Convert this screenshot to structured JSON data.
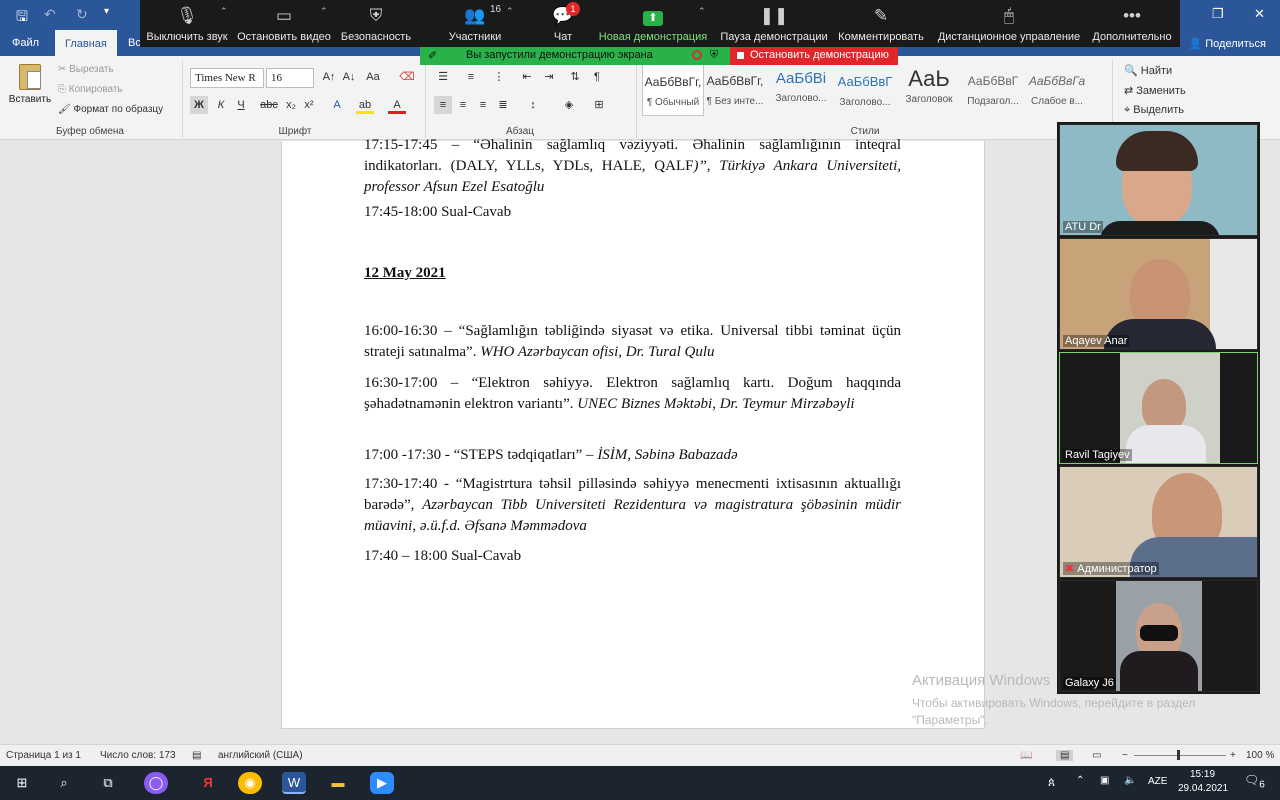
{
  "word": {
    "tabs": [
      "Файл",
      "Главная",
      "Вс"
    ],
    "share_label": "Поделиться",
    "clipboard": {
      "paste": "Вставить",
      "cut": "Вырезать",
      "copy": "Копировать",
      "format_painter": "Формат по образцу",
      "group": "Буфер обмена"
    },
    "font": {
      "name": "Times New R",
      "size": "16",
      "group": "Шрифт"
    },
    "paragraph_group": "Абзац",
    "styles": {
      "items": [
        {
          "preview": "АаБбВвГг,",
          "name": "¶ Обычный"
        },
        {
          "preview": "АаБбВвГг,",
          "name": "¶ Без инте..."
        },
        {
          "preview": "АаБбВі",
          "name": "Заголово..."
        },
        {
          "preview": "АаБбВвГ",
          "name": "Заголово..."
        },
        {
          "preview": "АаЬ",
          "name": "Заголовок"
        },
        {
          "preview": "АаБбВвГ",
          "name": "Подзагол..."
        },
        {
          "preview": "АаБбВвГа",
          "name": "Слабое в..."
        }
      ],
      "group": "Стили"
    },
    "editing": {
      "find": "Найти",
      "replace": "Заменить",
      "select": "Выделить"
    }
  },
  "zoom": {
    "toolbar": [
      {
        "label": "Выключить звук",
        "icon": "microphone-icon"
      },
      {
        "label": "Остановить видео",
        "icon": "video-camera-icon"
      },
      {
        "label": "Безопасность",
        "icon": "shield-icon"
      },
      {
        "label": "Участники",
        "icon": "participants-icon",
        "count": "16"
      },
      {
        "label": "Чат",
        "icon": "chat-icon",
        "badge": "1"
      },
      {
        "label": "Новая демонстрация",
        "icon": "share-screen-icon"
      },
      {
        "label": "Пауза демонстрации",
        "icon": "pause-icon"
      },
      {
        "label": "Комментировать",
        "icon": "pencil-icon"
      },
      {
        "label": "Дистанционное управление",
        "icon": "mouse-icon"
      },
      {
        "label": "Дополнительно",
        "icon": "more-icon"
      }
    ],
    "share_status": "Вы запустили демонстрацию экрана",
    "stop_share": "Остановить демонстрацию",
    "participants": [
      {
        "name": "ATU Dr"
      },
      {
        "name": "Aqayev Anar"
      },
      {
        "name": "Ravil Tagiyev"
      },
      {
        "name": "Администратор"
      },
      {
        "name": "Galaxy J6"
      }
    ]
  },
  "document": {
    "p1": {
      "text": "17:15-17:45 – “Əhalinin sağlamlıq vəziyyəti. Əhalinin sağlamlığının inteqral indikatorları. (DALY, YLLs, YDLs, HALE, QALF",
      "italic": ")”, Türkiyə Ankara Universiteti, professor Afsun Ezel Esatoğlu"
    },
    "p2": "17:45-18:00 Sual-Cavab",
    "heading": "12 May 2021",
    "p3": {
      "text": "16:00-16:30 – “Sağlamlığın təbliğində siyasət və etika. Universal tibbi təminat üçün strateji satınalma”.",
      "italic": "WHO Azərbaycan ofisi, Dr. Tural Qulu"
    },
    "p4": {
      "text": "16:30-17:00 – “Elektron səhiyyə. Elektron sağlamlıq kartı. Doğum haqqında şəhadətnamənin elektron variantı”.",
      "italic": "UNEC Biznes Məktəbi, Dr. Teymur Mirzəbəyli"
    },
    "p5": {
      "text": "17:00 -17:30 - “STEPS tədqiqatları” –",
      "italic": "İSİM, Səbinə Babazadə"
    },
    "p6": {
      "text": "17:30-17:40 - “Magistrtura təhsil pilləsində səhiyyə menecmenti ixtisasının aktuallığı barədə”,",
      "italic": "Azərbaycan Tibb Universiteti Rezidentura və magistratura şöbəsinin müdir müavini, ə.ü.f.d. Əfsanə Məmmədova"
    },
    "p7": "17:40 – 18:00 Sual-Cavab"
  },
  "watermark": {
    "title": "Активация Windows",
    "subtitle": "Чтобы активировать Windows, перейдите в раздел \"Параметры\"."
  },
  "status": {
    "page": "Страница 1 из 1",
    "words": "Число слов: 173",
    "language": "английский (США)",
    "zoom": "100 %"
  },
  "taskbar": {
    "lang": "AZE",
    "time": "15:19",
    "date": "29.04.2021",
    "notifications": "6"
  }
}
